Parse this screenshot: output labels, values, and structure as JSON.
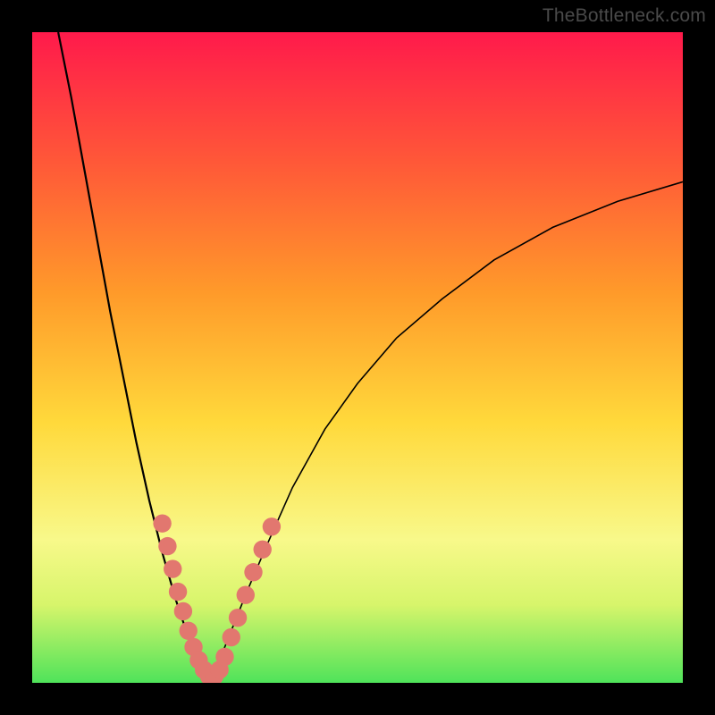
{
  "watermark": "TheBottleneck.com",
  "colors": {
    "frame": "#000000",
    "gradient_stops": [
      {
        "pct": 0,
        "hex": "#ff1a4b"
      },
      {
        "pct": 20,
        "hex": "#ff5838"
      },
      {
        "pct": 40,
        "hex": "#ff9a2a"
      },
      {
        "pct": 60,
        "hex": "#ffd93b"
      },
      {
        "pct": 78,
        "hex": "#f8f98a"
      },
      {
        "pct": 88,
        "hex": "#d7f56b"
      },
      {
        "pct": 100,
        "hex": "#4fe35a"
      }
    ],
    "curve_stroke": "#000000",
    "dot_fill": "#e2776f"
  },
  "chart_data": {
    "type": "line",
    "title": "",
    "xlabel": "",
    "ylabel": "",
    "xlim": [
      0,
      100
    ],
    "ylim": [
      0,
      100
    ],
    "note": "Axes are unlabeled in source image; x/y expressed in percent of plot area. y=0 is bottom (green), y=100 is top (red). Left and right branches form a V-shaped valley with minimum near x≈27.",
    "series": [
      {
        "name": "left-branch",
        "x": [
          4,
          6,
          8,
          10,
          12,
          14,
          16,
          18,
          20,
          22,
          23,
          24,
          25,
          26,
          27
        ],
        "y": [
          100,
          90,
          79,
          68,
          57,
          47,
          37,
          28,
          20,
          13,
          10,
          7,
          4,
          2,
          0
        ]
      },
      {
        "name": "right-branch",
        "x": [
          27,
          29,
          31,
          33,
          36,
          40,
          45,
          50,
          56,
          63,
          71,
          80,
          90,
          100
        ],
        "y": [
          0,
          4,
          9,
          14,
          21,
          30,
          39,
          46,
          53,
          59,
          65,
          70,
          74,
          77
        ]
      }
    ],
    "marker_points": {
      "name": "highlighted-dots",
      "comment": "Pink circular markers clustered around the valley of the V.",
      "points": [
        {
          "x": 20.0,
          "y": 24.5,
          "r": 1.4
        },
        {
          "x": 20.8,
          "y": 21.0,
          "r": 1.4
        },
        {
          "x": 21.6,
          "y": 17.5,
          "r": 1.4
        },
        {
          "x": 22.4,
          "y": 14.0,
          "r": 1.4
        },
        {
          "x": 23.2,
          "y": 11.0,
          "r": 1.4
        },
        {
          "x": 24.0,
          "y": 8.0,
          "r": 1.4
        },
        {
          "x": 24.8,
          "y": 5.5,
          "r": 1.4
        },
        {
          "x": 25.6,
          "y": 3.5,
          "r": 1.4
        },
        {
          "x": 26.4,
          "y": 2.0,
          "r": 1.4
        },
        {
          "x": 27.2,
          "y": 1.0,
          "r": 1.4
        },
        {
          "x": 28.0,
          "y": 1.0,
          "r": 1.4
        },
        {
          "x": 28.8,
          "y": 2.0,
          "r": 1.4
        },
        {
          "x": 29.6,
          "y": 4.0,
          "r": 1.4
        },
        {
          "x": 30.6,
          "y": 7.0,
          "r": 1.4
        },
        {
          "x": 31.6,
          "y": 10.0,
          "r": 1.4
        },
        {
          "x": 32.8,
          "y": 13.5,
          "r": 1.4
        },
        {
          "x": 34.0,
          "y": 17.0,
          "r": 1.4
        },
        {
          "x": 35.4,
          "y": 20.5,
          "r": 1.4
        },
        {
          "x": 36.8,
          "y": 24.0,
          "r": 1.4
        }
      ]
    }
  }
}
